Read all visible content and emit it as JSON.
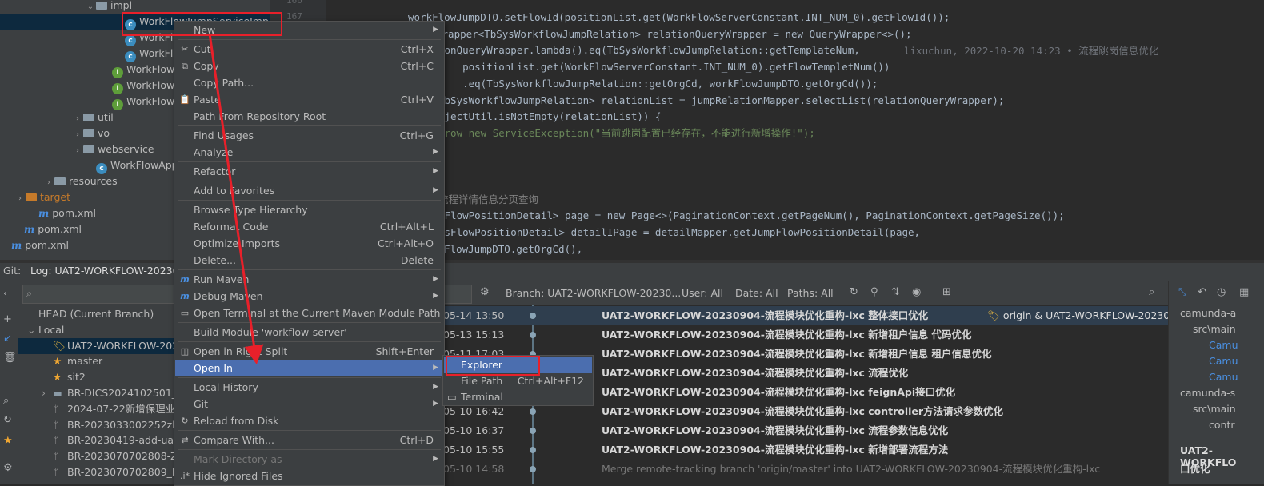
{
  "project_tree": [
    {
      "label": "impl",
      "indent": 120,
      "kind": "folder",
      "arrow": "⌄"
    },
    {
      "label": "WorkFlowJumpServiceImpl",
      "indent": 156,
      "kind": "class",
      "selected": true
    },
    {
      "label": "WorkFlo",
      "indent": 156,
      "kind": "class"
    },
    {
      "label": "WorkFlo",
      "indent": 156,
      "kind": "class"
    },
    {
      "label": "WorkFlowJ",
      "indent": 140,
      "kind": "interface"
    },
    {
      "label": "WorkFlowF",
      "indent": 140,
      "kind": "interface"
    },
    {
      "label": "WorkFlowS",
      "indent": 140,
      "kind": "interface"
    },
    {
      "label": "util",
      "indent": 104,
      "kind": "folder",
      "arrow": "›"
    },
    {
      "label": "vo",
      "indent": 104,
      "kind": "folder",
      "arrow": "›"
    },
    {
      "label": "webservice",
      "indent": 104,
      "kind": "folder",
      "arrow": "›"
    },
    {
      "label": "WorkFlowApp",
      "indent": 120,
      "kind": "class"
    },
    {
      "label": "resources",
      "indent": 68,
      "kind": "folder",
      "arrow": "›"
    },
    {
      "label": "target",
      "indent": 32,
      "kind": "folder-orange",
      "arrow": "›"
    },
    {
      "label": "pom.xml",
      "indent": 48,
      "kind": "maven"
    },
    {
      "label": "pom.xml",
      "indent": 30,
      "kind": "maven"
    },
    {
      "label": "pom.xml",
      "indent": 10,
      "kind": "maven"
    }
  ],
  "editor": {
    "line_numbers": [
      "166",
      "167"
    ],
    "lines": [
      "workFlowJumpDTO.setFlowId(positionList.get(WorkFlowServerConstant.INT_NUM_0).getFlowId());",
      "Wrapper<TbSysWorkflowJumpRelation> relationQueryWrapper = new QueryWrapper<>();",
      "ionQueryWrapper.lambda().eq(TbSysWorkflowJumpRelation::getTemplateNum,",
      "    positionList.get(WorkFlowServerConstant.INT_NUM_0).getFlowTempletNum())",
      "    .eq(TbSysWorkflowJumpRelation::getOrgCd, workFlowJumpDTO.getOrgCd());",
      "TbSysWorkflowJumpRelation> relationList = jumpRelationMapper.selectList(relationQueryWrapper);",
      "ojectUtil.isNotEmpty(relationList)) {",
      "hrow new ServiceException(\"当前跳岗配置已经存在，不能进行新增操作!\");",
      "",
      "",
      "",
      "流程详情信息分页查询",
      "sFlowPositionDetail> page = new Page<>(PaginationContext.getPageNum(), PaginationContext.getPageSize());",
      "ysFlowPositionDetail> detailIPage = detailMapper.getJumpFlowPositionDetail(page,",
      "rkFlowJumpDTO.getOrgCd(),"
    ],
    "blame": "lixuchun, 2022-10-20 14:23 • 流程跳岗信息优化"
  },
  "git_bar": {
    "prefix": "Git:",
    "tab": "Log: UAT2-WORKFLOW-20230904"
  },
  "branches": [
    {
      "label": "HEAD (Current Branch)",
      "indent": 48,
      "icon": ""
    },
    {
      "label": "Local",
      "indent": 48,
      "icon": "",
      "arrow": "⌄"
    },
    {
      "label": "UAT2-WORKFLOW-2023",
      "indent": 66,
      "icon": "tag",
      "selected": true
    },
    {
      "label": "master",
      "indent": 66,
      "icon": "star"
    },
    {
      "label": "sit2",
      "indent": 66,
      "icon": "star"
    },
    {
      "label": "BR-DICS2024102501_ZW",
      "indent": 66,
      "icon": "folder",
      "arrow": "›"
    },
    {
      "label": "2024-07-22新增保理业务",
      "indent": 66,
      "icon": "branch"
    },
    {
      "label": "BR-2023033002252zha",
      "indent": 66,
      "icon": "branch"
    },
    {
      "label": "BR-20230419-add-uat",
      "indent": 66,
      "icon": "branch"
    },
    {
      "label": "BR-2023070702808-ZW",
      "indent": 66,
      "icon": "branch"
    },
    {
      "label": "BR-2023070702809_LZI",
      "indent": 66,
      "icon": "branch"
    }
  ],
  "log_toolbar": {
    "branch": "Branch: UAT2-WORKFLOW-20230...",
    "user": "User: All",
    "date": "Date: All",
    "paths": "Paths: All"
  },
  "log_rows": [
    {
      "date": "05-14 13:50",
      "msg": "UAT2-WORKFLOW-20230904-流程模块优化重构-lxc 整体接口优化",
      "ref": "origin & UAT2-WORKFLOW-20230..."
    },
    {
      "date": "05-13 15:13",
      "msg": "UAT2-WORKFLOW-20230904-流程模块优化重构-lxc 新增租户信息 代码优化",
      "ref": ""
    },
    {
      "date": "05-11 17:03",
      "msg": "UAT2-WORKFLOW-20230904-流程模块优化重构-lxc 新增租户信息 租户信息优化",
      "ref": ""
    },
    {
      "date": "",
      "msg": "UAT2-WORKFLOW-20230904-流程模块优化重构-lxc 流程优化",
      "ref": ""
    },
    {
      "date": "",
      "msg": "UAT2-WORKFLOW-20230904-流程模块优化重构-lxc feignApi接口优化",
      "ref": ""
    },
    {
      "date": "05-10 16:42",
      "msg": "UAT2-WORKFLOW-20230904-流程模块优化重构-lxc controller方法请求参数优化",
      "ref": ""
    },
    {
      "date": "05-10 16:37",
      "msg": "UAT2-WORKFLOW-20230904-流程模块优化重构-lxc 流程参数信息优化",
      "ref": ""
    },
    {
      "date": "05-10 15:55",
      "msg": "UAT2-WORKFLOW-20230904-流程模块优化重构-lxc 新增部署流程方法",
      "ref": ""
    },
    {
      "date": "05-10 14:58",
      "msg": "Merge remote-tracking branch 'origin/master' into UAT2-WORKFLOW-20230904-流程模块优化重构-lxc",
      "ref": ""
    }
  ],
  "right_panel": {
    "items": [
      "camunda-a",
      "src\\main",
      "Camu",
      "Camu",
      "Camu",
      "camunda-s",
      "src\\main",
      "contr"
    ],
    "footer_line1": "UAT2-WORKFLO",
    "footer_line2": "口优化"
  },
  "context_menu": [
    {
      "label": "New",
      "shortcut": "",
      "submenu": true,
      "icon": ""
    },
    {
      "sep": true
    },
    {
      "label": "Cut",
      "shortcut": "Ctrl+X",
      "icon": "✂"
    },
    {
      "label": "Copy",
      "shortcut": "Ctrl+C",
      "icon": "⧉"
    },
    {
      "label": "Copy Path...",
      "shortcut": "",
      "icon": ""
    },
    {
      "label": "Paste",
      "shortcut": "Ctrl+V",
      "icon": "📋"
    },
    {
      "label": "Path From Repository Root",
      "shortcut": "",
      "icon": ""
    },
    {
      "sep": true
    },
    {
      "label": "Find Usages",
      "shortcut": "Ctrl+G",
      "icon": ""
    },
    {
      "label": "Analyze",
      "shortcut": "",
      "submenu": true,
      "icon": ""
    },
    {
      "sep": true
    },
    {
      "label": "Refactor",
      "shortcut": "",
      "submenu": true,
      "icon": ""
    },
    {
      "sep": true
    },
    {
      "label": "Add to Favorites",
      "shortcut": "",
      "submenu": true,
      "icon": ""
    },
    {
      "sep": true
    },
    {
      "label": "Browse Type Hierarchy",
      "shortcut": "",
      "icon": ""
    },
    {
      "label": "Reformat Code",
      "shortcut": "Ctrl+Alt+L",
      "icon": ""
    },
    {
      "label": "Optimize Imports",
      "shortcut": "Ctrl+Alt+O",
      "icon": ""
    },
    {
      "label": "Delete...",
      "shortcut": "Delete",
      "icon": ""
    },
    {
      "sep": true
    },
    {
      "label": "Run Maven",
      "shortcut": "",
      "submenu": true,
      "icon": "m"
    },
    {
      "label": "Debug Maven",
      "shortcut": "",
      "submenu": true,
      "icon": "m"
    },
    {
      "label": "Open Terminal at the Current Maven Module Path",
      "shortcut": "",
      "icon": "▭"
    },
    {
      "sep": true
    },
    {
      "label": "Build Module 'workflow-server'",
      "shortcut": "",
      "icon": ""
    },
    {
      "sep": true
    },
    {
      "label": "Open in Right Split",
      "shortcut": "Shift+Enter",
      "icon": "◫"
    },
    {
      "label": "Open In",
      "shortcut": "",
      "submenu": true,
      "icon": "",
      "active": true
    },
    {
      "sep": true
    },
    {
      "label": "Local History",
      "shortcut": "",
      "submenu": true,
      "icon": ""
    },
    {
      "label": "Git",
      "shortcut": "",
      "submenu": true,
      "icon": ""
    },
    {
      "label": "Reload from Disk",
      "shortcut": "",
      "icon": "↻"
    },
    {
      "sep": true
    },
    {
      "label": "Compare With...",
      "shortcut": "Ctrl+D",
      "icon": "⇄"
    },
    {
      "sep": true
    },
    {
      "label": "Mark Directory as",
      "shortcut": "",
      "submenu": true,
      "icon": "",
      "disabled": true
    },
    {
      "label": "Hide Ignored Files",
      "shortcut": "",
      "icon": ".i*"
    }
  ],
  "submenu_open_in": [
    {
      "label": "Explorer",
      "shortcut": "",
      "active": true
    },
    {
      "label": "File Path",
      "shortcut": "Ctrl+Alt+F12"
    },
    {
      "label": "Terminal",
      "shortcut": "",
      "icon": "▭"
    }
  ],
  "colors": {
    "accent": "#4b6eaf",
    "annotation": "#e8202a"
  }
}
